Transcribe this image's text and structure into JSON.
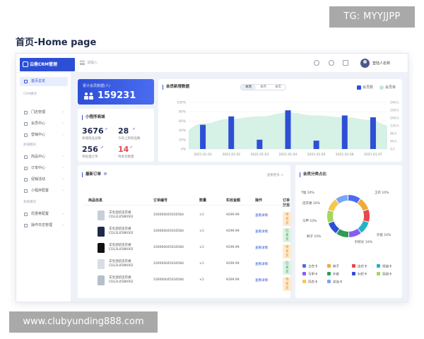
{
  "watermarks": {
    "top": "TG: MYYJJPP",
    "bottom": "www.clubyunding888.com"
  },
  "heading": "首页-Home page",
  "topbar": {
    "logo": "云鼎CRM管理",
    "search_placeholder": "请输入",
    "username": "登陆人名称"
  },
  "sidebar": {
    "items": [
      {
        "label": "首页总览",
        "icon": "home-icon",
        "active": true
      },
      {
        "label": "门店管理",
        "icon": "store-icon"
      },
      {
        "label": "会员中心",
        "icon": "user-icon"
      },
      {
        "label": "营销中心",
        "icon": "gift-icon"
      },
      {
        "label": "商品中心",
        "icon": "box-icon"
      },
      {
        "label": "订单中心",
        "icon": "list-icon"
      },
      {
        "label": "促销活动",
        "icon": "tag-icon"
      },
      {
        "label": "小程序配置",
        "icon": "app-icon"
      },
      {
        "label": "优惠券配置",
        "icon": "coupon-icon"
      },
      {
        "label": "操作日志管理",
        "icon": "log-icon"
      }
    ],
    "groups": [
      "CRM模块",
      "商城模块",
      "系统模块"
    ]
  },
  "total_card": {
    "label": "累计会员数据(人)",
    "value": "159231"
  },
  "mini_program": {
    "title": "小程序商城",
    "stats": [
      {
        "value": "3676",
        "label": "商城商品总数"
      },
      {
        "value": "28",
        "label": "今日上新商品数"
      },
      {
        "value": "256",
        "label": "待处理订单"
      },
      {
        "value": "14",
        "label": "待发货数量"
      }
    ]
  },
  "member_chart": {
    "title": "会员新增数据",
    "tabs": [
      "本周",
      "本月",
      "本年"
    ],
    "legend": [
      {
        "name": "会员数",
        "color": "#2d4fd6"
      },
      {
        "name": "会员率",
        "color": "#bfe8d6"
      }
    ]
  },
  "chart_data": {
    "type": "bar",
    "categories": [
      "2021.01.01",
      "2021.01.02",
      "2021.01.03",
      "2021.01.04",
      "2021.01.05",
      "2021.01.06",
      "2021.01.07"
    ],
    "series": [
      {
        "name": "会员数",
        "values": [
          52,
          70,
          20,
          83,
          18,
          72,
          68
        ]
      },
      {
        "name": "会员率",
        "values": [
          55,
          65,
          70,
          78,
          72,
          68,
          62
        ]
      }
    ],
    "y_left_ticks": [
      "100%",
      "80%",
      "60%",
      "40%",
      "20%",
      "0%"
    ],
    "y_right_ticks": [
      "240人",
      "200人",
      "160人",
      "120人",
      "80人",
      "40人",
      "0人"
    ],
    "ylim": [
      0,
      100
    ]
  },
  "orders": {
    "title": "最新订单",
    "more": "查看更多 >",
    "columns": [
      "商品信息",
      "订单编号",
      "数量",
      "实收金额",
      "操作",
      "订单状态"
    ],
    "rows": [
      {
        "name": "羊毛混纺连衣裙",
        "sku": "CDL2L058K002",
        "order_no": "100000045030584",
        "qty": "×1",
        "amount": "¥299.99",
        "action": "查看详情",
        "status": "待发货",
        "status_color": "orange",
        "item_color": "#c8ced9"
      },
      {
        "name": "羊毛混纺连衣裙",
        "sku": "CDL2L058K002",
        "order_no": "100000045030584",
        "qty": "×1",
        "amount": "¥299.99",
        "action": "查看详情",
        "status": "已发货",
        "status_color": "green",
        "item_color": "#1f2a4a"
      },
      {
        "name": "羊毛混纺连衣裙",
        "sku": "CDL2L058K002",
        "order_no": "100000045030584",
        "qty": "×1",
        "amount": "¥299.99",
        "action": "查看详情",
        "status": "待发货",
        "status_color": "orange",
        "item_color": "#111111"
      },
      {
        "name": "羊毛混纺连衣裙",
        "sku": "CDL2L058K002",
        "order_no": "100000045030584",
        "qty": "×1",
        "amount": "¥299.99",
        "action": "查看详情",
        "status": "已发货",
        "status_color": "green",
        "item_color": "#d8dde6"
      },
      {
        "name": "羊毛混纺连衣裙",
        "sku": "CDL2L058K002",
        "order_no": "100000045030584",
        "qty": "×1",
        "amount": "¥299.99",
        "action": "查看详情",
        "status": "待发货",
        "status_color": "orange",
        "item_color": "#b6bfcc"
      }
    ]
  },
  "category_pie": {
    "title": "会员分类占比",
    "slices": [
      {
        "name": "卫衣",
        "value": 10,
        "color": "#4a6cf0"
      },
      {
        "name": "T恤",
        "value": 10,
        "color": "#f0a93a"
      },
      {
        "name": "连衣裙",
        "value": 10,
        "color": "#e5484d"
      },
      {
        "name": "马甲",
        "value": 10,
        "color": "#22b3c4"
      },
      {
        "name": "针织衫",
        "value": 10,
        "color": "#8a5cf0"
      },
      {
        "name": "外套",
        "value": 10,
        "color": "#2e9b57"
      },
      {
        "name": "裤子",
        "value": 10,
        "color": "#2d4fd6"
      },
      {
        "name": "裙装",
        "value": 10,
        "color": "#a4d65e"
      },
      {
        "name": "卫裤",
        "value": 10,
        "color": "#f5c84c"
      },
      {
        "name": "衬衫",
        "value": 10,
        "color": "#7aa7f5"
      }
    ],
    "callouts": [
      "卫衣 10%",
      "T恤 10%",
      "连衣裙 10%",
      "马甲 10%",
      "外套 10%",
      "裤子 10%",
      "针织衫 10%"
    ],
    "legend": [
      "卫衣卡",
      "裤子",
      "连衣卡",
      "短袖卡",
      "马甲卡",
      "外套",
      "针织卡",
      "羽绒卡",
      "风衣卡",
      "夹克卡"
    ]
  }
}
